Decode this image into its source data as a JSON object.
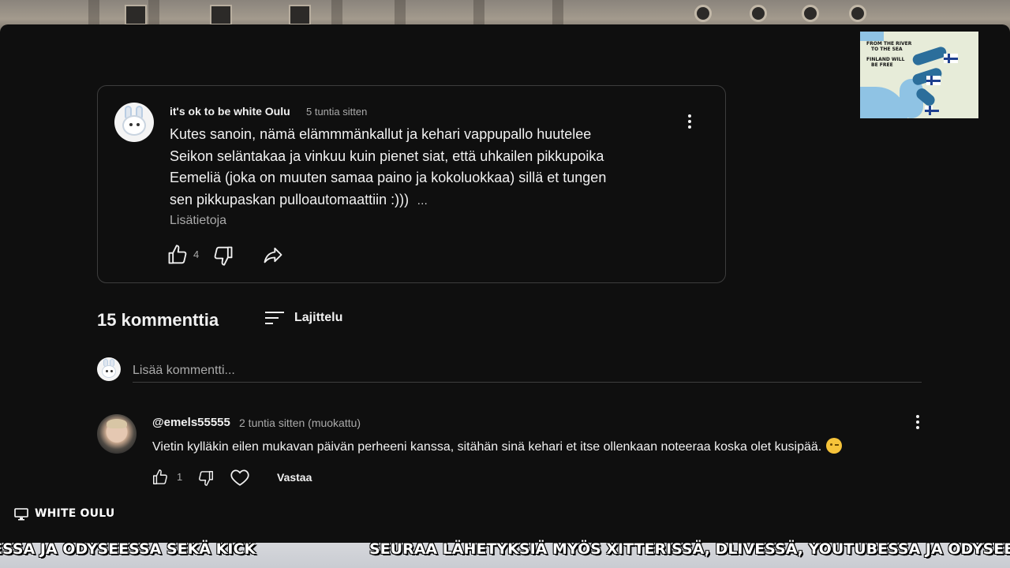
{
  "featured_comment": {
    "author": "it's ok to be white Oulu",
    "time": "5 tuntia sitten",
    "text_lines": [
      "Kutes sanoin, nämä elämmmänkallut ja kehari vappupallo huutelee",
      "Seikon seläntakaa ja vinkuu kuin pienet siat, että uhkailen pikkupoika",
      "Eemeliä (joka on muuten samaa paino ja kokoluokkaa) sillä et tungen",
      "sen pikkupaskan pulloautomaattiin :)))"
    ],
    "ellipsis": "…",
    "read_more": "Lisätietoja",
    "like_count": "4"
  },
  "comments_header": {
    "count_label": "15 kommenttia",
    "sort_label": "Lajittelu"
  },
  "add_comment": {
    "placeholder": "Lisää kommentti..."
  },
  "reply_comment": {
    "author": "@emels55555",
    "time": "2 tuntia sitten (muokattu)",
    "text": "Vietin kylläkin eilen mukavan päivän perheeni kanssa, sitähän sinä kehari et itse ollenkaan noteeraa koska olet kusipää.",
    "like_count": "1",
    "reply_label": "Vastaa"
  },
  "overlay_map": {
    "line1": "FROM THE RIVER",
    "line2": "TO THE SEA",
    "line3": "FINLAND WILL",
    "line4": "BE FREE"
  },
  "stream": {
    "channel_label": "WHITE OULU",
    "ticker_left": "ESSA JA ODYSEESSA SEKÄ KICK",
    "ticker_right": "SEURAA LÄHETYKSIÄ MYÖS XITTERISSÄ, DLIVESSÄ, YOUTUBESSA JA ODYSEESSA SEKÄ KICK"
  }
}
